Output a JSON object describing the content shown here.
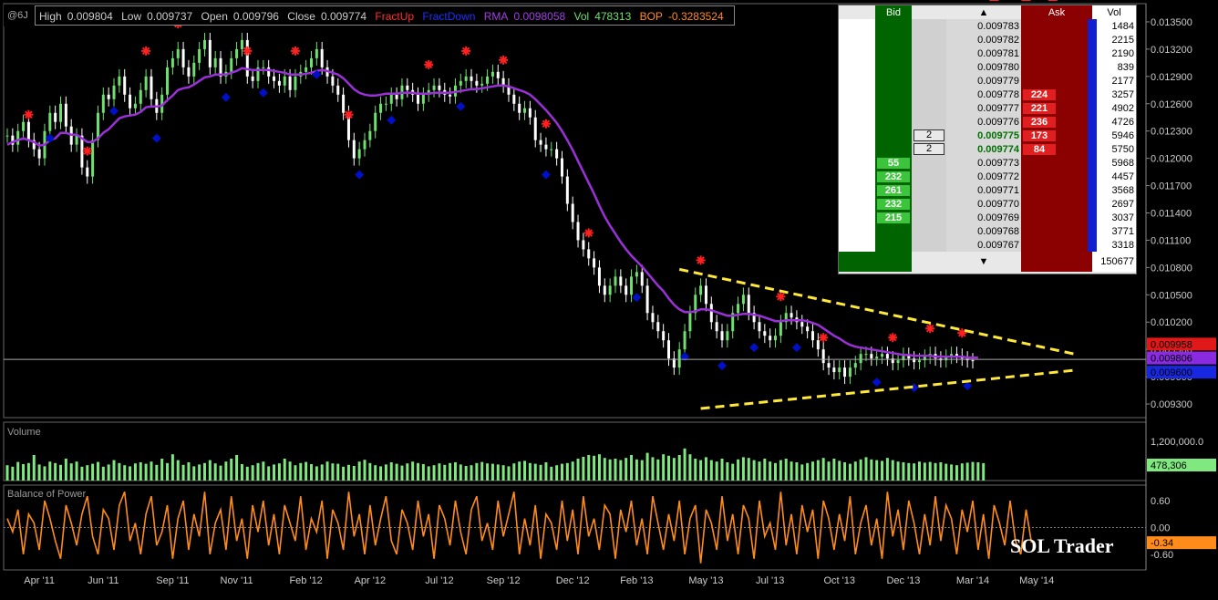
{
  "header": {
    "symbol": "@6J",
    "high_label": "High",
    "high": "0.009804",
    "low_label": "Low",
    "low": "0.009737",
    "open_label": "Open",
    "open": "0.009796",
    "close_label": "Close",
    "close": "0.009774",
    "fractup": "FractUp",
    "fractdown": "FractDown",
    "rma_label": "RMA",
    "rma": "0.0098058",
    "vol_label": "Vol",
    "vol": "478313",
    "bop_label": "BOP",
    "bop": "-0.3283524"
  },
  "dom": {
    "bid_label": "Bid",
    "ask_label": "Ask",
    "vol_label": "Vol",
    "rows": [
      {
        "price": "0.009783",
        "bid": "",
        "ask": "",
        "vol": "1484",
        "mine": ""
      },
      {
        "price": "0.009782",
        "bid": "",
        "ask": "",
        "vol": "2215",
        "mine": ""
      },
      {
        "price": "0.009781",
        "bid": "",
        "ask": "",
        "vol": "2190",
        "mine": ""
      },
      {
        "price": "0.009780",
        "bid": "",
        "ask": "",
        "vol": "839",
        "mine": ""
      },
      {
        "price": "0.009779",
        "bid": "",
        "ask": "",
        "vol": "2177",
        "mine": ""
      },
      {
        "price": "0.009778",
        "bid": "",
        "ask": "224",
        "vol": "3257",
        "mine": ""
      },
      {
        "price": "0.009777",
        "bid": "",
        "ask": "221",
        "vol": "4902",
        "mine": ""
      },
      {
        "price": "0.009776",
        "bid": "",
        "ask": "236",
        "vol": "4726",
        "mine": ""
      },
      {
        "price": "0.009775",
        "bid": "",
        "ask": "173",
        "vol": "5946",
        "mine": "2"
      },
      {
        "price": "0.009774",
        "bid": "",
        "ask": "84",
        "vol": "5750",
        "mine": "2"
      },
      {
        "price": "0.009773",
        "bid": "55",
        "ask": "",
        "vol": "5968",
        "mine": ""
      },
      {
        "price": "0.009772",
        "bid": "232",
        "ask": "",
        "vol": "4457",
        "mine": ""
      },
      {
        "price": "0.009771",
        "bid": "261",
        "ask": "",
        "vol": "3568",
        "mine": ""
      },
      {
        "price": "0.009770",
        "bid": "232",
        "ask": "",
        "vol": "2697",
        "mine": ""
      },
      {
        "price": "0.009769",
        "bid": "215",
        "ask": "",
        "vol": "3037",
        "mine": ""
      },
      {
        "price": "0.009768",
        "bid": "",
        "ask": "",
        "vol": "3771",
        "mine": ""
      },
      {
        "price": "0.009767",
        "bid": "",
        "ask": "",
        "vol": "3318",
        "mine": ""
      }
    ],
    "total_vol": "150677",
    "up_arrow": "▲",
    "down_arrow": "▼"
  },
  "chart_data": [
    {
      "type": "line",
      "title": "",
      "y_ticks": [
        "0.013500",
        "0.013200",
        "0.012900",
        "0.012600",
        "0.012300",
        "0.012000",
        "0.011700",
        "0.011400",
        "0.011100",
        "0.010800",
        "0.010500",
        "0.010200",
        "0.009900",
        "0.009600",
        "0.009300"
      ],
      "y_tick_values": [
        0.0135,
        0.0132,
        0.0129,
        0.0126,
        0.0123,
        0.012,
        0.0117,
        0.0114,
        0.0111,
        0.0108,
        0.0105,
        0.0102,
        0.0099,
        0.0096,
        0.0093
      ],
      "ylim": [
        0.00915,
        0.0137
      ],
      "x_ticks": [
        "Apr '11",
        "Jun '11",
        "Sep '11",
        "Nov '11",
        "Feb '12",
        "Apr '12",
        "Jul '12",
        "Sep '12",
        "Dec '12",
        "Feb '13",
        "May '13",
        "Jul '13",
        "Oct '13",
        "Dec '13",
        "Mar '14",
        "May '14"
      ],
      "x_tick_index": [
        6,
        18,
        31,
        43,
        56,
        68,
        81,
        93,
        106,
        118,
        131,
        143,
        156,
        168,
        181,
        193
      ],
      "price_labels": {
        "red": "0.009958",
        "purple": "0.009806",
        "blue": "0.009600"
      },
      "close": [
        0.01225,
        0.01215,
        0.0123,
        0.0124,
        0.0122,
        0.0121,
        0.012,
        0.0123,
        0.0125,
        0.0124,
        0.0126,
        0.01235,
        0.01215,
        0.01225,
        0.0119,
        0.0118,
        0.0122,
        0.0125,
        0.0127,
        0.01265,
        0.0128,
        0.0129,
        0.0127,
        0.01255,
        0.0126,
        0.01275,
        0.0129,
        0.01265,
        0.0125,
        0.0127,
        0.013,
        0.0131,
        0.0132,
        0.013,
        0.0129,
        0.01305,
        0.0132,
        0.0133,
        0.013,
        0.0131,
        0.0129,
        0.01295,
        0.0131,
        0.0132,
        0.0133,
        0.0129,
        0.01285,
        0.013,
        0.013,
        0.0129,
        0.01285,
        0.0128,
        0.0129,
        0.01275,
        0.0129,
        0.01295,
        0.013,
        0.0131,
        0.0132,
        0.013,
        0.0129,
        0.0128,
        0.0127,
        0.0125,
        0.0122,
        0.012,
        0.0121,
        0.0122,
        0.0123,
        0.0125,
        0.0126,
        0.0126,
        0.0127,
        0.01265,
        0.0128,
        0.01275,
        0.0127,
        0.0126,
        0.0127,
        0.01275,
        0.0128,
        0.01275,
        0.0127,
        0.01268,
        0.0128,
        0.01285,
        0.0129,
        0.01285,
        0.0128,
        0.01282,
        0.0129,
        0.01295,
        0.01288,
        0.0128,
        0.0127,
        0.0126,
        0.0125,
        0.01255,
        0.01245,
        0.0122,
        0.01215,
        0.0121,
        0.0121,
        0.012,
        0.0118,
        0.0115,
        0.0113,
        0.0111,
        0.011,
        0.0109,
        0.0108,
        0.0106,
        0.0105,
        0.0106,
        0.0107,
        0.0106,
        0.0105,
        0.0107,
        0.01075,
        0.0106,
        0.0103,
        0.0102,
        0.0101,
        0.01,
        0.0098,
        0.0097,
        0.0099,
        0.0101,
        0.0103,
        0.0105,
        0.0106,
        0.0104,
        0.0102,
        0.0101,
        0.01,
        0.0101,
        0.0103,
        0.0104,
        0.0105,
        0.0103,
        0.0102,
        0.0101,
        0.01005,
        0.01,
        0.01005,
        0.0102,
        0.0103,
        0.01025,
        0.0102,
        0.01015,
        0.0101,
        0.01,
        0.0099,
        0.00975,
        0.0097,
        0.00965,
        0.0097,
        0.0096,
        0.0097,
        0.00975,
        0.00985,
        0.00985,
        0.0098,
        0.00982,
        0.00985,
        0.0098,
        0.00975,
        0.00978,
        0.00984,
        0.0098,
        0.00976,
        0.00978,
        0.00982,
        0.00985,
        0.0098,
        0.00978,
        0.00982,
        0.00985,
        0.00983,
        0.0098,
        0.00978,
        0.00977
      ],
      "rma": [
        0.01215,
        0.01218,
        0.0122,
        0.01222,
        0.0122,
        0.01218,
        0.01214,
        0.01215,
        0.0122,
        0.01222,
        0.01228,
        0.01228,
        0.01226,
        0.01226,
        0.01222,
        0.01218,
        0.01218,
        0.01222,
        0.01228,
        0.01232,
        0.01238,
        0.01244,
        0.01246,
        0.01247,
        0.01248,
        0.01251,
        0.01256,
        0.01257,
        0.01257,
        0.01258,
        0.01264,
        0.01269,
        0.01275,
        0.01277,
        0.01278,
        0.01281,
        0.01285,
        0.01289,
        0.0129,
        0.01292,
        0.01292,
        0.01292,
        0.01294,
        0.01296,
        0.01299,
        0.01298,
        0.01297,
        0.01297,
        0.01297,
        0.01297,
        0.01296,
        0.01295,
        0.01294,
        0.01292,
        0.01292,
        0.01292,
        0.01293,
        0.01294,
        0.01296,
        0.01297,
        0.01296,
        0.01294,
        0.01292,
        0.01288,
        0.01282,
        0.01276,
        0.01272,
        0.0127,
        0.01269,
        0.01269,
        0.0127,
        0.01271,
        0.01271,
        0.01271,
        0.01272,
        0.01272,
        0.01272,
        0.01271,
        0.01271,
        0.01271,
        0.01272,
        0.01272,
        0.01272,
        0.01272,
        0.01273,
        0.01274,
        0.01275,
        0.01276,
        0.01276,
        0.01277,
        0.01278,
        0.01279,
        0.0128,
        0.0128,
        0.01279,
        0.01277,
        0.01275,
        0.01273,
        0.0127,
        0.01265,
        0.01259,
        0.01253,
        0.01246,
        0.01239,
        0.0123,
        0.0122,
        0.01209,
        0.01197,
        0.01185,
        0.01173,
        0.01161,
        0.01148,
        0.01136,
        0.01126,
        0.01117,
        0.01108,
        0.011,
        0.01093,
        0.01087,
        0.01081,
        0.01074,
        0.01067,
        0.0106,
        0.01054,
        0.01046,
        0.01039,
        0.01034,
        0.01031,
        0.01031,
        0.01032,
        0.01034,
        0.01034,
        0.01033,
        0.01031,
        0.01029,
        0.01027,
        0.01027,
        0.01028,
        0.01029,
        0.01029,
        0.01028,
        0.01027,
        0.01025,
        0.01023,
        0.01021,
        0.01021,
        0.01022,
        0.01022,
        0.01022,
        0.01022,
        0.01021,
        0.01019,
        0.01017,
        0.01013,
        0.01009,
        0.01005,
        0.01002,
        0.00998,
        0.00995,
        0.00993,
        0.00992,
        0.00991,
        0.0099,
        0.00989,
        0.00988,
        0.00987,
        0.00986,
        0.00985,
        0.00984,
        0.00984,
        0.00983,
        0.00983,
        0.00983,
        0.00983,
        0.00982,
        0.00982,
        0.00982,
        0.00982,
        0.00982,
        0.00982,
        0.00981,
        0.00981,
        0.00981
      ],
      "fract_up_index": [
        4,
        15,
        26,
        32,
        37,
        45,
        54,
        64,
        79,
        86,
        93,
        101,
        109,
        130,
        145,
        153,
        166,
        173,
        179,
        185,
        191,
        196
      ],
      "fract_down_index": [
        8,
        20,
        28,
        41,
        48,
        58,
        66,
        72,
        85,
        101,
        118,
        127,
        134,
        140,
        148,
        163,
        170,
        180,
        185,
        189,
        194,
        199
      ],
      "trendlines": [
        {
          "from_index": 126,
          "from_value": 0.01078,
          "to_index": 200,
          "to_value": 0.00985
        },
        {
          "from_index": 130,
          "from_value": 0.00925,
          "to_index": 200,
          "to_value": 0.00967
        }
      ]
    },
    {
      "type": "bar",
      "title": "Volume",
      "y_ticks": [
        "1,200,000.0"
      ],
      "ylim": [
        0,
        1600000
      ],
      "last_value_label": "478,306",
      "values": [
        420000,
        380000,
        510000,
        450000,
        480000,
        700000,
        440000,
        390000,
        520000,
        480000,
        430000,
        600000,
        470000,
        520000,
        380000,
        420000,
        460000,
        510000,
        380000,
        440000,
        560000,
        480000,
        420000,
        390000,
        470000,
        500000,
        460000,
        520000,
        430000,
        600000,
        480000,
        720000,
        560000,
        430000,
        500000,
        390000,
        440000,
        480000,
        560000,
        470000,
        410000,
        520000,
        600000,
        700000,
        450000,
        380000,
        420000,
        480000,
        520000,
        390000,
        440000,
        470000,
        600000,
        520000,
        420000,
        480000,
        510000,
        450000,
        390000,
        440000,
        520000,
        470000,
        460000,
        380000,
        430000,
        400000,
        520000,
        570000,
        480000,
        420000,
        390000,
        440000,
        500000,
        460000,
        410000,
        470000,
        520000,
        480000,
        450000,
        390000,
        420000,
        470000,
        430000,
        480000,
        500000,
        440000,
        400000,
        420000,
        480000,
        510000,
        470000,
        460000,
        440000,
        420000,
        390000,
        470000,
        520000,
        540000,
        480000,
        460000,
        430000,
        500000,
        380000,
        420000,
        460000,
        480000,
        520000,
        600000,
        650000,
        700000,
        680000,
        720000,
        620000,
        580000,
        600000,
        560000,
        620000,
        700000,
        580000,
        560000,
        760000,
        640000,
        580000,
        720000,
        680000,
        620000,
        700000,
        880000,
        720000,
        600000,
        560000,
        640000,
        560000,
        520000,
        600000,
        500000,
        460000,
        580000,
        640000,
        620000,
        560000,
        520000,
        600000,
        520000,
        480000,
        560000,
        600000,
        520000,
        500000,
        440000,
        480000,
        520000,
        560000,
        620000,
        520000,
        600000,
        540000,
        500000,
        460000,
        520000,
        580000,
        640000,
        580000,
        560000,
        540000,
        620000,
        560000,
        520000,
        500000,
        480000,
        470000,
        520000,
        490000,
        510000,
        480000,
        500000,
        460000,
        440000,
        420000,
        470000,
        490000,
        510000,
        500000,
        478306
      ]
    },
    {
      "type": "line",
      "title": "Balance of Power",
      "y_ticks": [
        "0.60",
        "0.00",
        "-0.60"
      ],
      "y_tick_values": [
        0.6,
        0.0,
        -0.6
      ],
      "ylim": [
        -0.95,
        0.95
      ],
      "last_value_label": "-0.34",
      "values": [
        0.2,
        -0.1,
        0.4,
        -0.6,
        0.3,
        0.1,
        -0.5,
        0.6,
        0.2,
        -0.3,
        -0.7,
        0.5,
        0.1,
        -0.4,
        0.3,
        0.7,
        -0.2,
        -0.6,
        0.4,
        0.2,
        -0.5,
        0.5,
        0.8,
        -0.3,
        0.1,
        -0.6,
        0.3,
        0.7,
        -0.4,
        -0.1,
        0.5,
        -0.7,
        0.2,
        0.6,
        -0.5,
        0.3,
        -0.2,
        0.8,
        -0.6,
        0.1,
        0.4,
        -0.5,
        0.7,
        -0.3,
        0.2,
        -0.7,
        0.5,
        -0.1,
        0.6,
        -0.4,
        0.3,
        -0.6,
        0.5,
        0.1,
        -0.3,
        0.7,
        -0.5,
        0.2,
        -0.1,
        0.6,
        -0.7,
        0.4,
        0.1,
        -0.5,
        0.8,
        -0.2,
        0.3,
        -0.6,
        0.5,
        -0.4,
        0.2,
        0.7,
        -0.3,
        -0.6,
        0.4,
        0.1,
        -0.5,
        0.6,
        -0.2,
        0.3,
        -0.7,
        0.5,
        0.2,
        -0.4,
        0.6,
        -0.1,
        -0.6,
        0.4,
        0.7,
        -0.3,
        0.1,
        -0.5,
        0.6,
        -0.2,
        0.3,
        0.8,
        -0.6,
        0.2,
        -0.4,
        0.5,
        -0.7,
        0.3,
        0.1,
        -0.5,
        0.6,
        -0.3,
        0.4,
        -0.6,
        0.7,
        -0.2,
        0.2,
        -0.5,
        0.5,
        0.3,
        -0.7,
        0.4,
        -0.1,
        0.6,
        -0.4,
        0.2,
        -0.6,
        0.7,
        0.1,
        -0.5,
        0.3,
        -0.3,
        0.6,
        -0.6,
        0.2,
        0.5,
        -0.8,
        0.4,
        0.1,
        -0.5,
        0.7,
        -0.3,
        0.3,
        -0.6,
        0.5,
        0.2,
        -0.7,
        0.6,
        -0.2,
        0.1,
        -0.5,
        0.8,
        -0.4,
        0.3,
        -0.6,
        0.5,
        -0.1,
        0.4,
        -0.7,
        0.6,
        0.2,
        -0.5,
        0.3,
        -0.3,
        0.7,
        -0.6,
        0.1,
        0.5,
        -0.4,
        0.2,
        -0.7,
        0.8,
        -0.2,
        0.4,
        -0.5,
        0.6,
        0.1,
        -0.6,
        0.3,
        -0.4,
        0.7,
        -0.3,
        0.5,
        0.2,
        -0.6,
        0.4,
        -0.1,
        0.6,
        -0.5,
        0.3,
        -0.7,
        0.5,
        0.1,
        -0.4,
        0.6,
        -0.3,
        -0.6,
        0.4,
        -0.34
      ]
    }
  ],
  "brand": "SOL Trader",
  "colors": {
    "bg": "#000000",
    "candle_up": "#6ee06e",
    "candle_down": "#ffffff",
    "rma": "#9b30d8",
    "fract_up": "#ff2020",
    "fract_down": "#0010c8",
    "trend": "#ffe83a",
    "volume": "#7fe87f",
    "bop": "#ff8c1a",
    "axis_text": "#cccccc",
    "grid_sep": "#666666"
  }
}
